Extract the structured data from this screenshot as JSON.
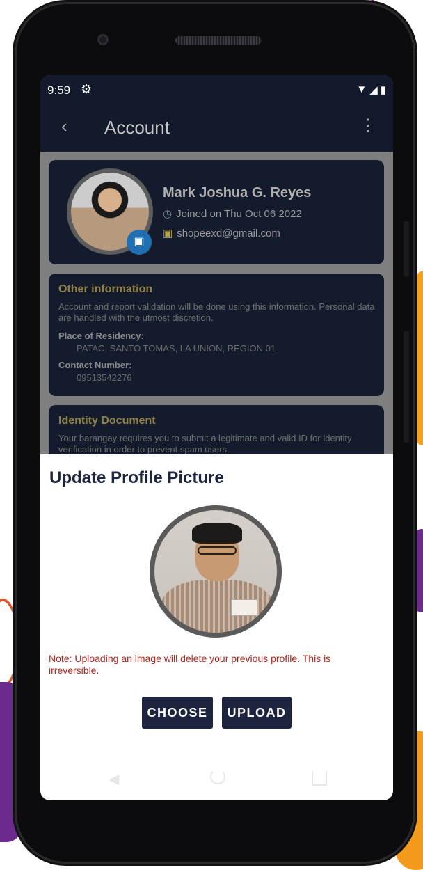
{
  "status_bar": {
    "time": "9:59",
    "icons": [
      "gear-icon",
      "wifi-icon",
      "signal-icon",
      "battery-icon"
    ]
  },
  "app_bar": {
    "title": "Account"
  },
  "profile_card": {
    "name": "Mark Joshua G. Reyes",
    "joined": "Joined on Thu Oct 06 2022",
    "email": "shopeexd@gmail.com"
  },
  "other_info": {
    "title": "Other information",
    "description": "Account and report validation will be done using this information. Personal data are handled with the utmost discretion.",
    "residency_label": "Place of Residency:",
    "residency_value": "PATAC, SANTO TOMAS, LA UNION, REGION 01",
    "contact_label": "Contact Number:",
    "contact_value": "09513542276"
  },
  "identity_doc": {
    "title": "Identity Document",
    "description": "Your barangay requires you to submit a legitimate and valid ID for identity verification in order to prevent spam users."
  },
  "sheet": {
    "title": "Update Profile Picture",
    "note": "Note: Uploading an image will delete your previous profile. This is irreversible.",
    "choose_label": "CHOOSE",
    "upload_label": "UPLOAD"
  },
  "colors": {
    "primary": "#1d2440",
    "card_bg": "#141b2c",
    "warning": "#b3261e",
    "section_title": "#8f8344"
  }
}
